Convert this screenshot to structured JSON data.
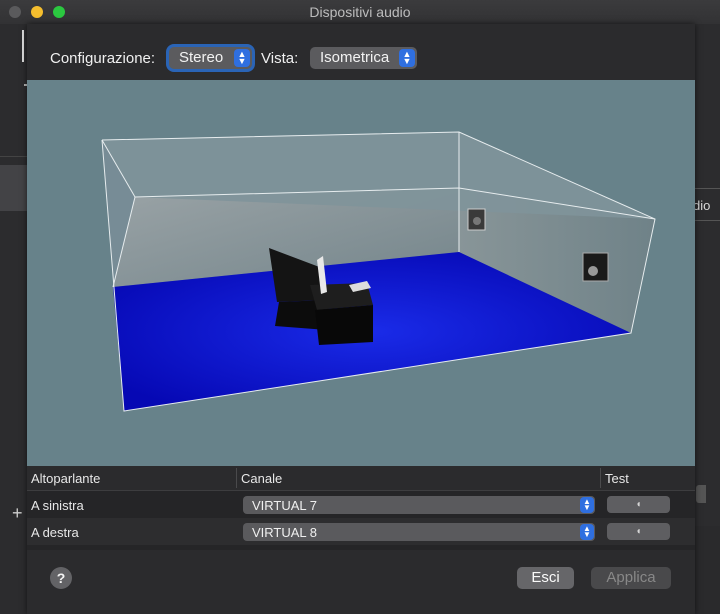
{
  "window": {
    "title": "Dispositivi audio"
  },
  "background": {
    "right_fragment": "dio",
    "add_symbol": "+"
  },
  "toolbar": {
    "config_label": "Configurazione:",
    "config_value": "Stereo",
    "view_label": "Vista:",
    "view_value": "Isometrica"
  },
  "table": {
    "columns": [
      "Altoparlante",
      "Canale",
      "Test"
    ],
    "rows": [
      {
        "speaker": "A sinistra",
        "channel": "VIRTUAL 7"
      },
      {
        "speaker": "A destra",
        "channel": "VIRTUAL 8"
      }
    ]
  },
  "footer": {
    "help": "?",
    "exit": "Esci",
    "apply": "Applica"
  },
  "colors": {
    "accent": "#2f6fe0",
    "floor": "#0a10c8",
    "viewport_bg": "#67828a"
  }
}
